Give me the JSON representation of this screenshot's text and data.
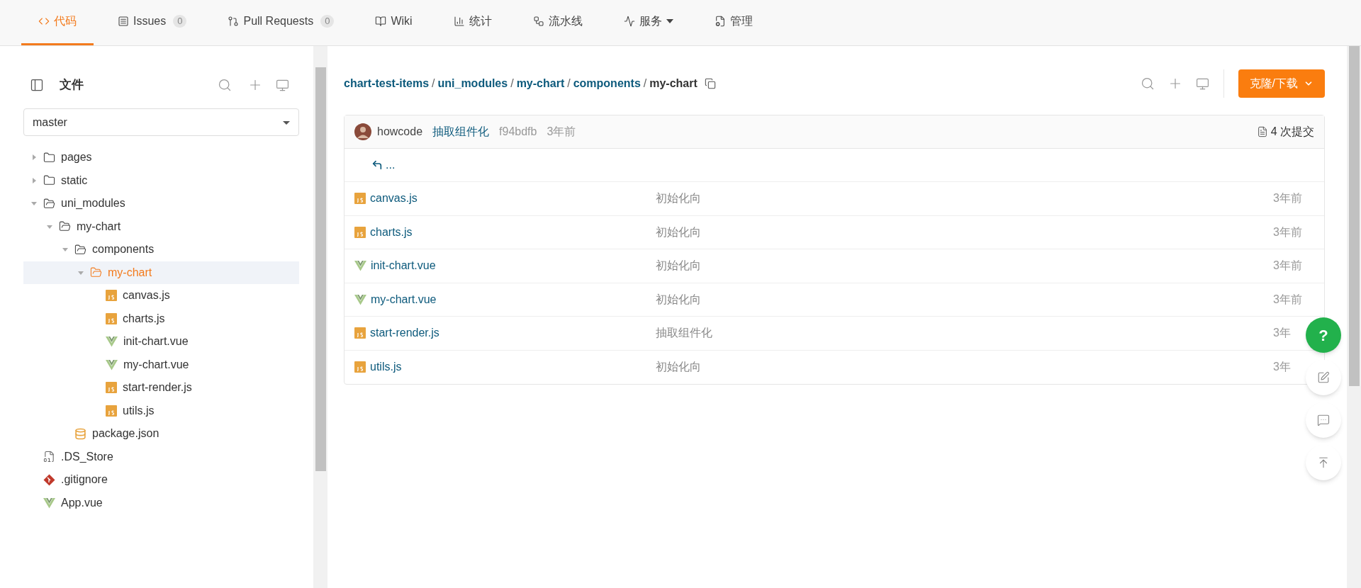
{
  "nav": {
    "tabs": [
      {
        "label": "代码",
        "selected": true,
        "dropdown": false
      },
      {
        "label": "Issues",
        "count": "0",
        "selected": false,
        "dropdown": false
      },
      {
        "label": "Pull Requests",
        "count": "0",
        "selected": false,
        "dropdown": false
      },
      {
        "label": "Wiki",
        "selected": false,
        "dropdown": false
      },
      {
        "label": "统计",
        "selected": false,
        "dropdown": false
      },
      {
        "label": "流水线",
        "selected": false,
        "dropdown": false
      },
      {
        "label": "服务",
        "selected": false,
        "dropdown": true
      },
      {
        "label": "管理",
        "selected": false,
        "dropdown": false
      }
    ]
  },
  "sidebar": {
    "title": "文件",
    "branch": "master",
    "tree": [
      {
        "name": "pages",
        "kind": "folder",
        "expanded": false,
        "selected": false
      },
      {
        "name": "static",
        "kind": "folder",
        "expanded": false,
        "selected": false
      },
      {
        "name": "uni_modules",
        "kind": "folder",
        "expanded": true,
        "selected": false,
        "children": [
          {
            "name": "my-chart",
            "kind": "folder",
            "expanded": true,
            "selected": false,
            "children": [
              {
                "name": "components",
                "kind": "folder",
                "expanded": true,
                "selected": false,
                "children": [
                  {
                    "name": "my-chart",
                    "kind": "folder",
                    "expanded": true,
                    "selected": true,
                    "children": [
                      {
                        "name": "canvas.js",
                        "kind": "js",
                        "selected": false
                      },
                      {
                        "name": "charts.js",
                        "kind": "js",
                        "selected": false
                      },
                      {
                        "name": "init-chart.vue",
                        "kind": "vue",
                        "selected": false
                      },
                      {
                        "name": "my-chart.vue",
                        "kind": "vue",
                        "selected": false
                      },
                      {
                        "name": "start-render.js",
                        "kind": "js",
                        "selected": false
                      },
                      {
                        "name": "utils.js",
                        "kind": "js",
                        "selected": false
                      }
                    ]
                  }
                ]
              },
              {
                "name": "package.json",
                "kind": "json",
                "selected": false
              }
            ]
          }
        ]
      },
      {
        "name": ".DS_Store",
        "kind": "file",
        "selected": false
      },
      {
        "name": ".gitignore",
        "kind": "git",
        "selected": false
      },
      {
        "name": "App.vue",
        "kind": "vue",
        "selected": false
      }
    ]
  },
  "main": {
    "separator": "/",
    "breadcrumb": [
      "chart-test-items",
      "uni_modules",
      "my-chart",
      "components",
      "my-chart"
    ],
    "clone_button": "克隆/下载",
    "commit": {
      "author": "howcode",
      "message": "抽取组件化",
      "hash": "f94bdfb",
      "time": "3年前",
      "count": "4 次提交"
    },
    "parent_row": "...",
    "files": [
      {
        "name": "canvas.js",
        "kind": "js",
        "message": "初始化向",
        "time": "3年前"
      },
      {
        "name": "charts.js",
        "kind": "js",
        "message": "初始化向",
        "time": "3年前"
      },
      {
        "name": "init-chart.vue",
        "kind": "vue",
        "message": "初始化向",
        "time": "3年前"
      },
      {
        "name": "my-chart.vue",
        "kind": "vue",
        "message": "初始化向",
        "time": "3年前"
      },
      {
        "name": "start-render.js",
        "kind": "js",
        "message": "抽取组件化",
        "time": "3年"
      },
      {
        "name": "utils.js",
        "kind": "js",
        "message": "初始化向",
        "time": "3年"
      }
    ]
  },
  "floating": [
    {
      "kind": "help",
      "label": "?"
    },
    {
      "kind": "feedback"
    },
    {
      "kind": "comment"
    },
    {
      "kind": "top"
    }
  ]
}
